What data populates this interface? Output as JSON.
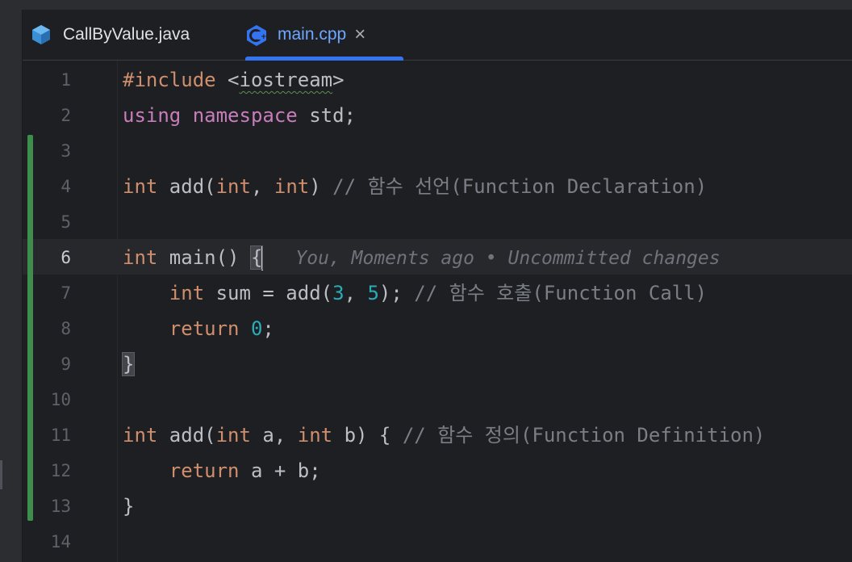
{
  "tabs": [
    {
      "label": "CallByValue.java",
      "icon": "java-class-icon",
      "active": false
    },
    {
      "label": "main.cpp",
      "icon": "cpp-file-icon",
      "active": true,
      "close": "×"
    }
  ],
  "colors": {
    "accent": "#3574f0",
    "vcs_modified": "#3e8e4b",
    "keyword": "#cf8e6d",
    "namespace_keyword": "#c77dbb",
    "number": "#2aacb8",
    "comment": "#7a7e85"
  },
  "editor": {
    "current_line": 6,
    "line_numbers": [
      "1",
      "2",
      "3",
      "4",
      "5",
      "6",
      "7",
      "8",
      "9",
      "10",
      "11",
      "12",
      "13",
      "14"
    ],
    "git_blame_hint": "You, Moments ago • Uncommitted changes",
    "lines": [
      [
        {
          "t": "#include ",
          "c": "kw"
        },
        {
          "t": "<",
          "c": ""
        },
        {
          "t": "iostream",
          "c": "sq"
        },
        {
          "t": ">",
          "c": ""
        }
      ],
      [
        {
          "t": "using",
          "c": "ns"
        },
        {
          "t": " ",
          "c": ""
        },
        {
          "t": "namespace",
          "c": "ns"
        },
        {
          "t": " std;",
          "c": ""
        }
      ],
      [],
      [
        {
          "t": "int",
          "c": "kw"
        },
        {
          "t": " add(",
          "c": ""
        },
        {
          "t": "int",
          "c": "kw"
        },
        {
          "t": ", ",
          "c": ""
        },
        {
          "t": "int",
          "c": "kw"
        },
        {
          "t": ") ",
          "c": ""
        },
        {
          "t": "// 함수 선언(Function Declaration)",
          "c": "cm"
        }
      ],
      [],
      [
        {
          "t": "int",
          "c": "kw"
        },
        {
          "t": " main() ",
          "c": ""
        },
        {
          "t": "{",
          "c": "bh"
        }
      ],
      [
        {
          "t": "    ",
          "c": ""
        },
        {
          "t": "int",
          "c": "kw"
        },
        {
          "t": " sum = add(",
          "c": ""
        },
        {
          "t": "3",
          "c": "num"
        },
        {
          "t": ", ",
          "c": ""
        },
        {
          "t": "5",
          "c": "num"
        },
        {
          "t": "); ",
          "c": ""
        },
        {
          "t": "// 함수 호출(Function Call)",
          "c": "cm"
        }
      ],
      [
        {
          "t": "    ",
          "c": ""
        },
        {
          "t": "return",
          "c": "kw"
        },
        {
          "t": " ",
          "c": ""
        },
        {
          "t": "0",
          "c": "num"
        },
        {
          "t": ";",
          "c": ""
        }
      ],
      [
        {
          "t": "}",
          "c": "bh"
        }
      ],
      [],
      [
        {
          "t": "int",
          "c": "kw"
        },
        {
          "t": " add(",
          "c": ""
        },
        {
          "t": "int",
          "c": "kw"
        },
        {
          "t": " a, ",
          "c": ""
        },
        {
          "t": "int",
          "c": "kw"
        },
        {
          "t": " b) { ",
          "c": ""
        },
        {
          "t": "// 함수 정의(Function Definition)",
          "c": "cm"
        }
      ],
      [
        {
          "t": "    ",
          "c": ""
        },
        {
          "t": "return",
          "c": "kw"
        },
        {
          "t": " a + b;",
          "c": ""
        }
      ],
      [
        {
          "t": "}",
          "c": ""
        }
      ],
      []
    ]
  }
}
